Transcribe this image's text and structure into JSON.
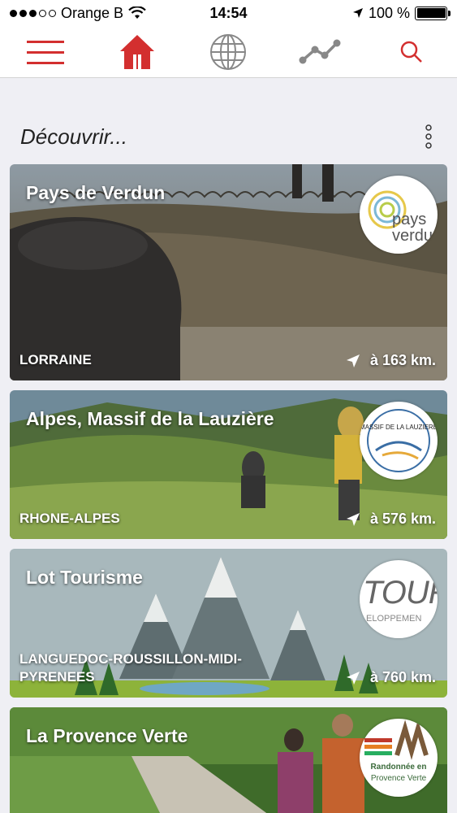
{
  "status_bar": {
    "carrier": "Orange B",
    "time": "14:54",
    "battery": "100 %"
  },
  "toolbar": {
    "items": [
      {
        "icon": "menu-icon"
      },
      {
        "icon": "home-icon"
      },
      {
        "icon": "globe-icon"
      },
      {
        "icon": "route-icon"
      },
      {
        "icon": "search-icon"
      }
    ],
    "accent_color": "#d32f2f"
  },
  "section": {
    "title": "Découvrir..."
  },
  "cards": [
    {
      "title": "Pays de Verdun",
      "region": "LORRAINE",
      "distance": "à 163 km.",
      "logo_text": "pays verdun"
    },
    {
      "title": "Alpes, Massif de la Lauzière",
      "region": "RHONE-ALPES",
      "distance": "à 576 km.",
      "logo_text": "MASSIF DE LA LAUZIERE"
    },
    {
      "title": "Lot Tourisme",
      "region": "LANGUEDOC-ROUSSILLON-MIDI-PYRENEES",
      "distance": "à 760 km.",
      "logo_text": "TOUR",
      "logo_subtext": "ELOPPEMEN"
    },
    {
      "title": "La Provence Verte",
      "region": "",
      "distance": "",
      "logo_text": "Randonnée en",
      "logo_subtext": "Provence Verte"
    }
  ]
}
